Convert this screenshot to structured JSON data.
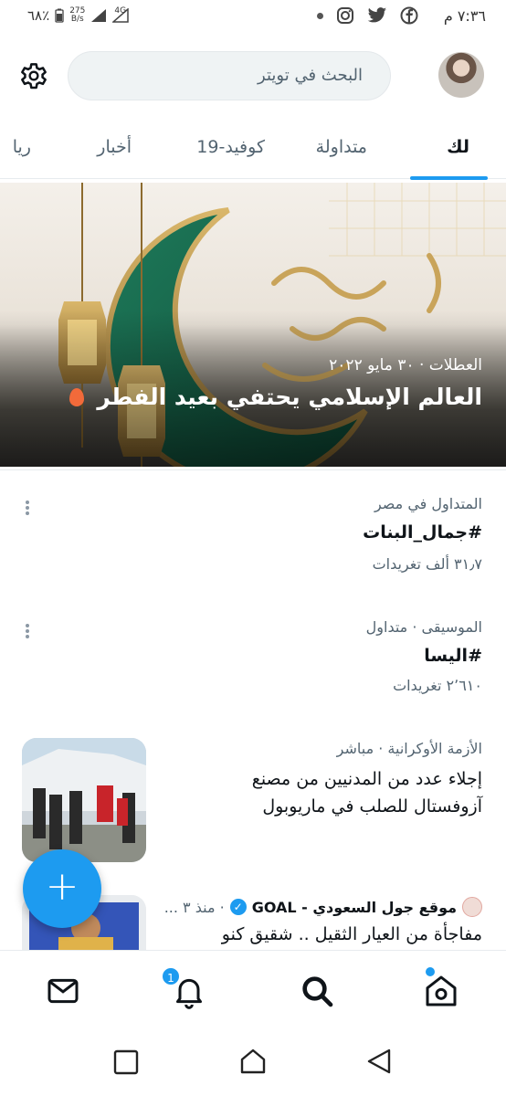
{
  "status_bar": {
    "battery": "٦٨٪",
    "net_speed_value": "275",
    "net_speed_unit": "B/s",
    "network": "4G",
    "time": "٧:٣٦ م"
  },
  "search": {
    "placeholder": "البحث في تويتر"
  },
  "tabs": [
    {
      "label": "لك",
      "active": true
    },
    {
      "label": "متداولة",
      "active": false
    },
    {
      "label": "كوفيد-19",
      "active": false
    },
    {
      "label": "أخبار",
      "active": false
    },
    {
      "label": "ريا",
      "active": false
    }
  ],
  "hero": {
    "meta": "العطلات · ٣٠ مايو ٢٠٢٢",
    "title": "العالم الإسلامي يحتفي بعيد الفطر"
  },
  "trends": [
    {
      "context": "المتداول في مصر",
      "name": "#جمال_البنات",
      "count": "٣١٫٧ ألف تغريدات"
    },
    {
      "context": "الموسيقى · متداول",
      "name": "#اليسا",
      "count": "٢٬٦١٠ تغريدات"
    }
  ],
  "news": {
    "context": "الأزمة الأوكرانية · مباشر",
    "title": "إجلاء عدد من المدنيين من مصنع آزوفستال للصلب في ماريوبول"
  },
  "goal_story": {
    "source": "موقع جول السعودي - GOAL",
    "time": "· منذ ٣ ...",
    "title": "مفاجأة من العيار الثقيل .. شقيق كنو"
  },
  "fab_label": "+",
  "bottom_nav": {
    "notifications_badge": "1"
  },
  "colors": {
    "accent": "#1d9bf0",
    "text": "#0f1419",
    "secondary": "#536471"
  }
}
